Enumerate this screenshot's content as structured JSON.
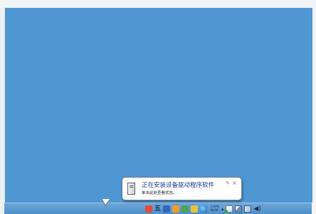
{
  "notification": {
    "title": "正在安装设备驱动程序软件",
    "subtitle": "单击此处查看状态。",
    "pin_glyph": "✎",
    "close_glyph": "×"
  },
  "tray": {
    "ime_label": "五",
    "caps_label": "CAPS",
    "caps_state": "NUM",
    "arrow": "▴",
    "volume_glyph": "◀)"
  },
  "icons": {
    "notification_icon": "device-driver-icon",
    "close": "close-icon",
    "pin": "pin-icon"
  },
  "colors": {
    "desktop": "#4e97d3",
    "taskbar": "#5a97cf",
    "balloon_title": "#1a3a8a"
  }
}
